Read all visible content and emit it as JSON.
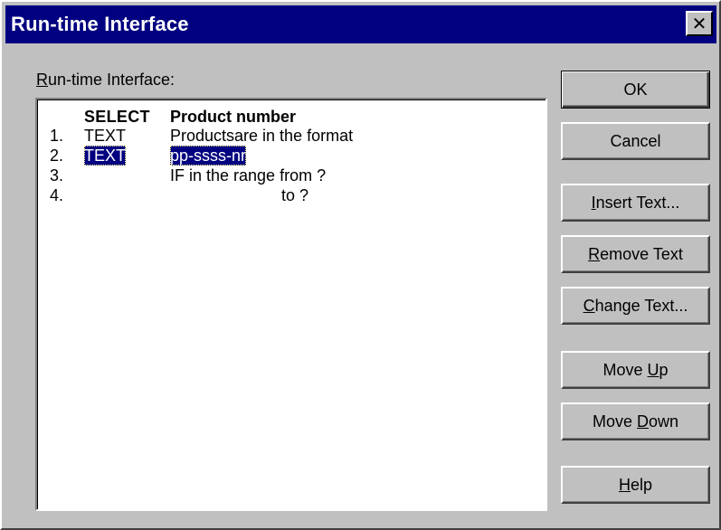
{
  "window": {
    "title": "Run-time Interface",
    "close_glyph": "✕"
  },
  "list": {
    "label_mnemonic": "R",
    "label_rest": "un-time Interface:",
    "header": {
      "keyword": "SELECT",
      "text": "Product number"
    },
    "rows": [
      {
        "num": "1.",
        "keyword": "TEXT",
        "text": "Productsare in the format"
      },
      {
        "num": "2.",
        "keyword": "TEXT",
        "text": "pp-ssss-nr",
        "selected": true
      },
      {
        "num": "3.",
        "keyword": "",
        "text": "IF in the range from ?"
      },
      {
        "num": "4.",
        "keyword": "",
        "text": "to ?"
      }
    ]
  },
  "buttons": {
    "ok": "OK",
    "cancel": "Cancel",
    "insert": {
      "mnemonic": "I",
      "rest": "nsert Text..."
    },
    "remove": {
      "mnemonic": "R",
      "rest": "emove Text"
    },
    "change": {
      "mnemonic": "C",
      "rest": "hange Text..."
    },
    "move_up": {
      "before": "Move ",
      "mnemonic": "U",
      "rest": "p"
    },
    "move_down": {
      "before": "Move ",
      "mnemonic": "D",
      "rest": "own"
    },
    "help": {
      "mnemonic": "H",
      "rest": "elp"
    }
  },
  "colors": {
    "titlebar": "#000080",
    "face": "#c0c0c0",
    "selection": "#000080"
  }
}
